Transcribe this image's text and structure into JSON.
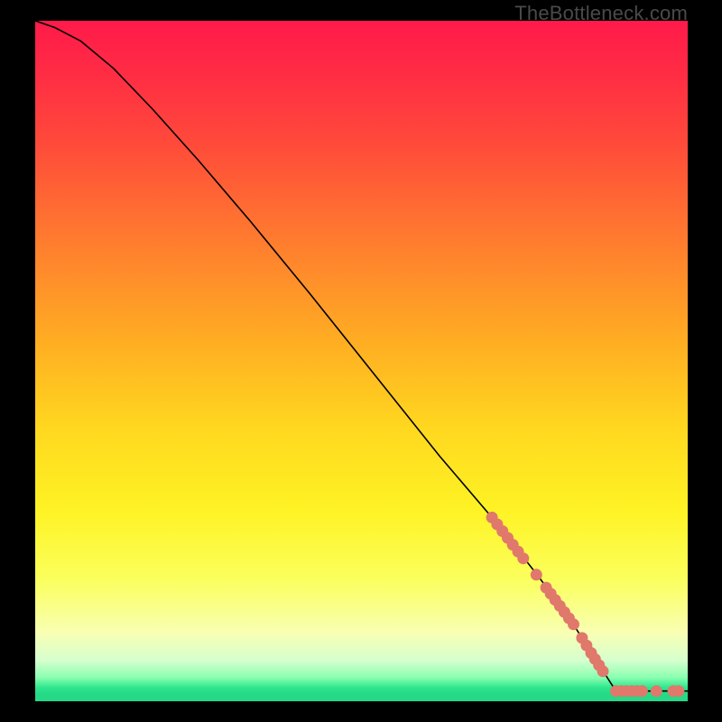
{
  "watermark": "TheBottleneck.com",
  "chart_data": {
    "type": "line",
    "title": "",
    "xlabel": "",
    "ylabel": "",
    "xlim": [
      0,
      100
    ],
    "ylim": [
      0,
      100
    ],
    "curve": [
      {
        "x": 0,
        "y": 100
      },
      {
        "x": 3,
        "y": 99
      },
      {
        "x": 7,
        "y": 97
      },
      {
        "x": 12,
        "y": 93
      },
      {
        "x": 18,
        "y": 87
      },
      {
        "x": 25,
        "y": 79.5
      },
      {
        "x": 33,
        "y": 70.5
      },
      {
        "x": 42,
        "y": 60
      },
      {
        "x": 52,
        "y": 48
      },
      {
        "x": 62,
        "y": 36
      },
      {
        "x": 70,
        "y": 27
      },
      {
        "x": 77,
        "y": 18.5
      },
      {
        "x": 82,
        "y": 12
      },
      {
        "x": 86,
        "y": 6
      },
      {
        "x": 88,
        "y": 3
      },
      {
        "x": 89,
        "y": 1.5
      },
      {
        "x": 100,
        "y": 1.5
      }
    ],
    "markers": [
      {
        "x": 70.0,
        "y": 27.0
      },
      {
        "x": 70.8,
        "y": 26.0
      },
      {
        "x": 71.6,
        "y": 25.0
      },
      {
        "x": 72.4,
        "y": 24.0
      },
      {
        "x": 73.2,
        "y": 23.0
      },
      {
        "x": 74.0,
        "y": 22.0
      },
      {
        "x": 74.8,
        "y": 21.0
      },
      {
        "x": 76.8,
        "y": 18.6
      },
      {
        "x": 78.3,
        "y": 16.7
      },
      {
        "x": 79.0,
        "y": 15.8
      },
      {
        "x": 79.7,
        "y": 14.9
      },
      {
        "x": 80.4,
        "y": 14.0
      },
      {
        "x": 81.1,
        "y": 13.1
      },
      {
        "x": 81.8,
        "y": 12.2
      },
      {
        "x": 82.5,
        "y": 11.3
      },
      {
        "x": 83.8,
        "y": 9.3
      },
      {
        "x": 84.5,
        "y": 8.2
      },
      {
        "x": 85.2,
        "y": 7.1
      },
      {
        "x": 85.8,
        "y": 6.2
      },
      {
        "x": 86.4,
        "y": 5.3
      },
      {
        "x": 87.0,
        "y": 4.4
      },
      {
        "x": 89.0,
        "y": 1.5
      },
      {
        "x": 89.8,
        "y": 1.5
      },
      {
        "x": 90.6,
        "y": 1.5
      },
      {
        "x": 91.4,
        "y": 1.5
      },
      {
        "x": 92.2,
        "y": 1.5
      },
      {
        "x": 93.0,
        "y": 1.5
      },
      {
        "x": 95.2,
        "y": 1.5
      },
      {
        "x": 97.8,
        "y": 1.5
      },
      {
        "x": 98.6,
        "y": 1.5
      }
    ],
    "gradient_bands": [
      {
        "color": "#ff1a4a",
        "stop": 0
      },
      {
        "color": "#ffd81f",
        "stop": 60
      },
      {
        "color": "#fbff5c",
        "stop": 82
      },
      {
        "color": "#25d986",
        "stop": 99
      }
    ]
  }
}
